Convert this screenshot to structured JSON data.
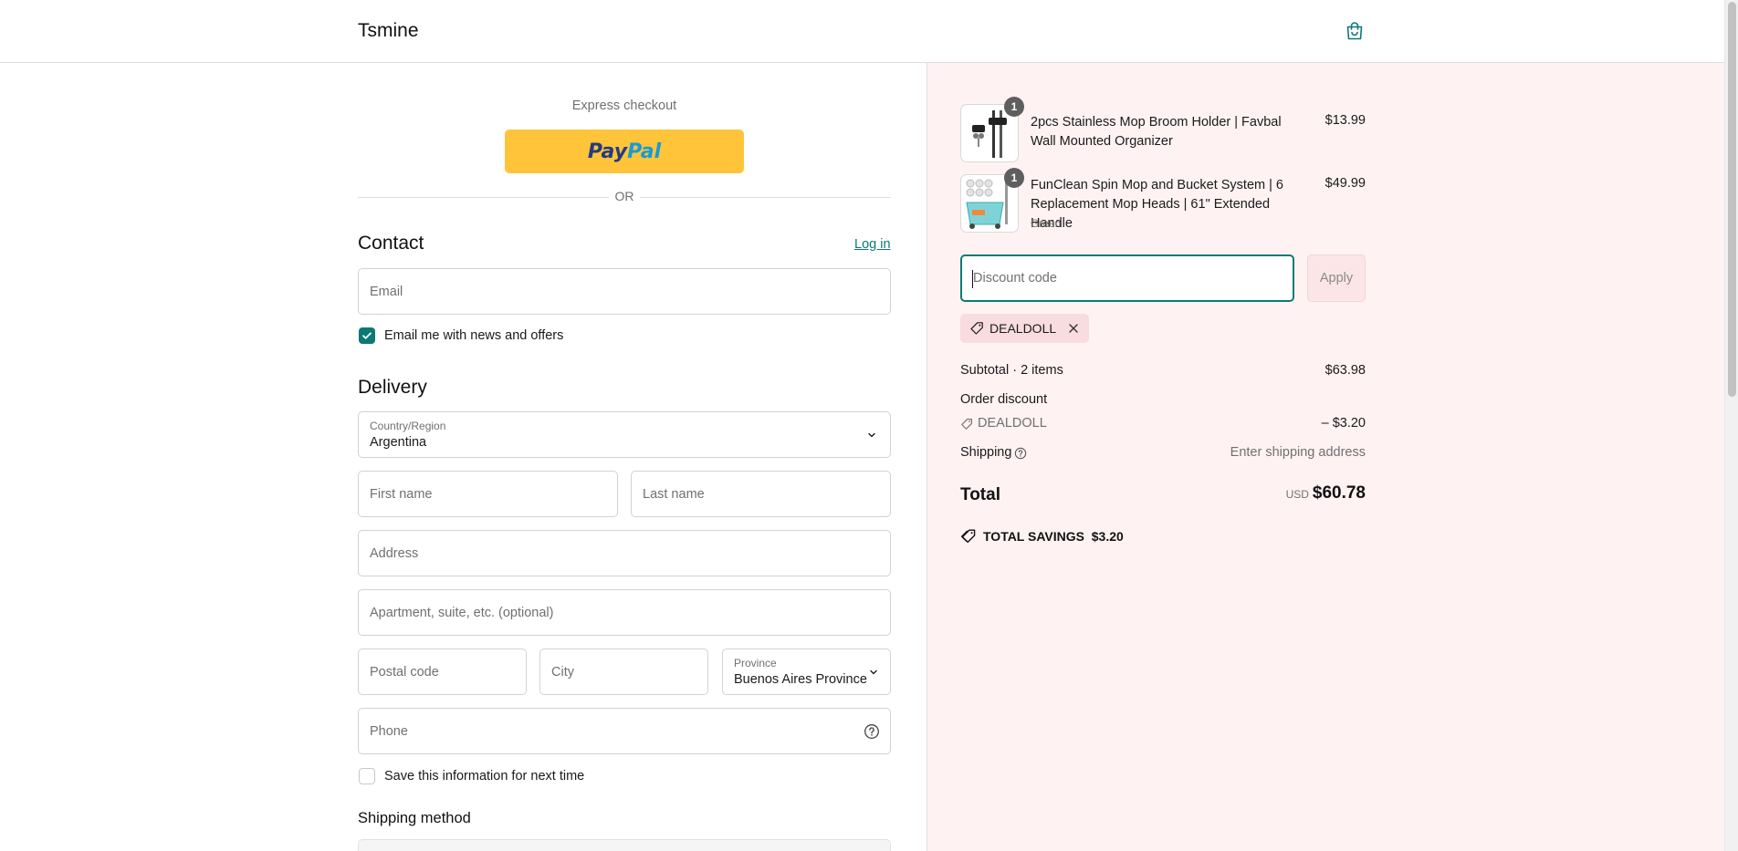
{
  "header": {
    "brand": "Tsmine",
    "cart_icon": "shopping-bag-icon"
  },
  "express": {
    "title": "Express checkout",
    "paypal_part1": "Pay",
    "paypal_part2": "Pal",
    "divider": "OR"
  },
  "contact": {
    "title": "Contact",
    "login": "Log in",
    "email_placeholder": "Email",
    "newsletter_label": "Email me with news and offers",
    "newsletter_checked": true
  },
  "delivery": {
    "title": "Delivery",
    "country_label": "Country/Region",
    "country_value": "Argentina",
    "first_name_placeholder": "First name",
    "last_name_placeholder": "Last name",
    "address_placeholder": "Address",
    "apartment_placeholder": "Apartment, suite, etc. (optional)",
    "postal_placeholder": "Postal code",
    "city_placeholder": "City",
    "province_label": "Province",
    "province_value": "Buenos Aires Province",
    "phone_placeholder": "Phone",
    "save_info_label": "Save this information for next time",
    "save_info_checked": false
  },
  "shipping_method": {
    "title": "Shipping method"
  },
  "order": {
    "items": [
      {
        "qty": "1",
        "name": "2pcs Stainless Mop Broom Holder | Favbal Wall Mounted Organizer",
        "variant": "",
        "price": "$13.99"
      },
      {
        "qty": "1",
        "name": "FunClean Spin Mop and Bucket System | 6 Replacement Mop Heads | 61\" Extended Handle",
        "variant": "Green",
        "price": "$49.99"
      }
    ],
    "discount_placeholder": "Discount code",
    "apply_label": "Apply",
    "applied_code": "DEALDOLL",
    "subtotal_label": "Subtotal · 2 items",
    "subtotal_value": "$63.98",
    "order_discount_label": "Order discount",
    "discount_code": "DEALDOLL",
    "discount_value": "– $3.20",
    "shipping_label": "Shipping",
    "shipping_value": "Enter shipping address",
    "total_label": "Total",
    "total_currency": "USD",
    "total_value": "$60.78",
    "savings_label": "TOTAL SAVINGS",
    "savings_value": "$3.20"
  },
  "colors": {
    "accent": "#0b7a75",
    "summary_bg": "#fff2f3",
    "paypal": "#ffc439"
  }
}
